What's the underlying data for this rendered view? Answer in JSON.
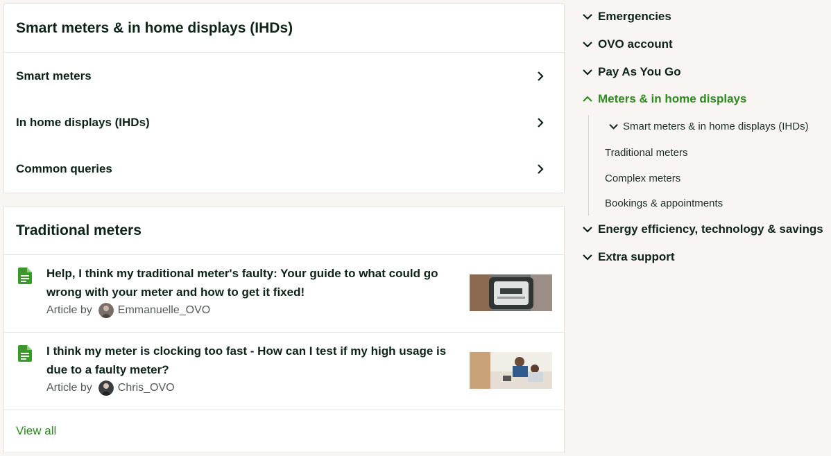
{
  "smart_section": {
    "title": "Smart meters & in home displays (IHDs)",
    "rows": [
      {
        "label": "Smart meters"
      },
      {
        "label": "In home displays (IHDs)"
      },
      {
        "label": "Common queries"
      }
    ]
  },
  "traditional_section": {
    "title": "Traditional meters",
    "articles": [
      {
        "title": "Help, I think my traditional meter's faulty: Your guide to what could go wrong with your meter and how to get it fixed!",
        "byline_prefix": "Article by",
        "author": "Emmanuelle_OVO"
      },
      {
        "title": "I think my meter is clocking too fast - How can I test if my high usage is due to a faulty meter?",
        "byline_prefix": "Article by",
        "author": "Chris_OVO"
      }
    ],
    "view_all": "View all"
  },
  "sidebar": {
    "items": [
      {
        "label": "Emergencies"
      },
      {
        "label": "OVO account"
      },
      {
        "label": "Pay As You Go"
      },
      {
        "label": "Meters & in home displays"
      },
      {
        "label": "Energy efficiency, technology & savings"
      },
      {
        "label": "Extra support"
      }
    ],
    "subitems": [
      {
        "label": "Smart meters & in home displays (IHDs)"
      },
      {
        "label": "Traditional meters"
      },
      {
        "label": "Complex meters"
      },
      {
        "label": "Bookings & appointments"
      }
    ]
  },
  "colors": {
    "accent_green": "#2d8a1f",
    "text_dark": "#0d2318",
    "page_bg": "#f8f5f2"
  },
  "icons": [
    "chevron-right-icon",
    "chevron-down-icon",
    "chevron-up-icon",
    "document-icon"
  ]
}
